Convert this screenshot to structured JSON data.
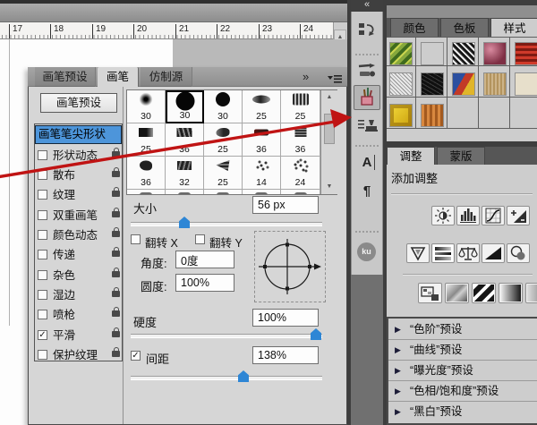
{
  "window": {
    "dock_collapse_icon": "«",
    "panel_more_icon": "»",
    "scroll_up_icon": "▲",
    "scroll_down_icon": "▼"
  },
  "ruler": {
    "numbers": [
      "17",
      "18",
      "19",
      "20",
      "21",
      "22",
      "23",
      "24"
    ]
  },
  "brush_panel": {
    "tabs": [
      {
        "label": "画笔预设"
      },
      {
        "label": "画笔"
      },
      {
        "label": "仿制源"
      }
    ],
    "presets_button": "画笔预设",
    "tip_shape_label": "画笔笔尖形状",
    "options": [
      {
        "label": "形状动态",
        "checked": false
      },
      {
        "label": "散布",
        "checked": false
      },
      {
        "label": "纹理",
        "checked": false
      },
      {
        "label": "双重画笔",
        "checked": false
      },
      {
        "label": "颜色动态",
        "checked": false
      },
      {
        "label": "传递",
        "checked": false
      },
      {
        "label": "杂色",
        "checked": false
      },
      {
        "label": "湿边",
        "checked": false
      },
      {
        "label": "喷枪",
        "checked": false
      },
      {
        "label": "平滑",
        "checked": true
      },
      {
        "label": "保护纹理",
        "checked": false
      }
    ],
    "grid_sizes": [
      "30",
      "30",
      "30",
      "25",
      "25",
      "25",
      "36",
      "25",
      "36",
      "36",
      "36",
      "32",
      "25",
      "14",
      "24"
    ],
    "selected_brush_index": 1,
    "size_label": "大小",
    "size_value": "56 px",
    "flip_x_label": "翻转 X",
    "flip_y_label": "翻转 Y",
    "angle_label": "角度:",
    "angle_value": "0度",
    "roundness_label": "圆度:",
    "roundness_value": "100%",
    "hardness_label": "硬度",
    "hardness_value": "100%",
    "spacing_label": "间距",
    "spacing_value": "138%"
  },
  "dock": {
    "character_label": "A",
    "paragraph_label": "¶",
    "kuler_label": "ku"
  },
  "right_panels": {
    "color_tabs": [
      {
        "label": "颜色"
      },
      {
        "label": "色板"
      },
      {
        "label": "样式"
      }
    ],
    "adjust_tabs": [
      {
        "label": "调整"
      },
      {
        "label": "蒙版"
      }
    ],
    "add_adjustment_label": "添加调整",
    "preset_groups": [
      {
        "label": "“色阶”预设"
      },
      {
        "label": "“曲线”预设"
      },
      {
        "label": "“曝光度”预设"
      },
      {
        "label": "“色相/饱和度”预设"
      },
      {
        "label": "“黑白”预设"
      }
    ]
  },
  "colors": {
    "accent_blue": "#2e86d5",
    "selection_blue": "#4d95da",
    "arrow_red": "#c01414"
  }
}
